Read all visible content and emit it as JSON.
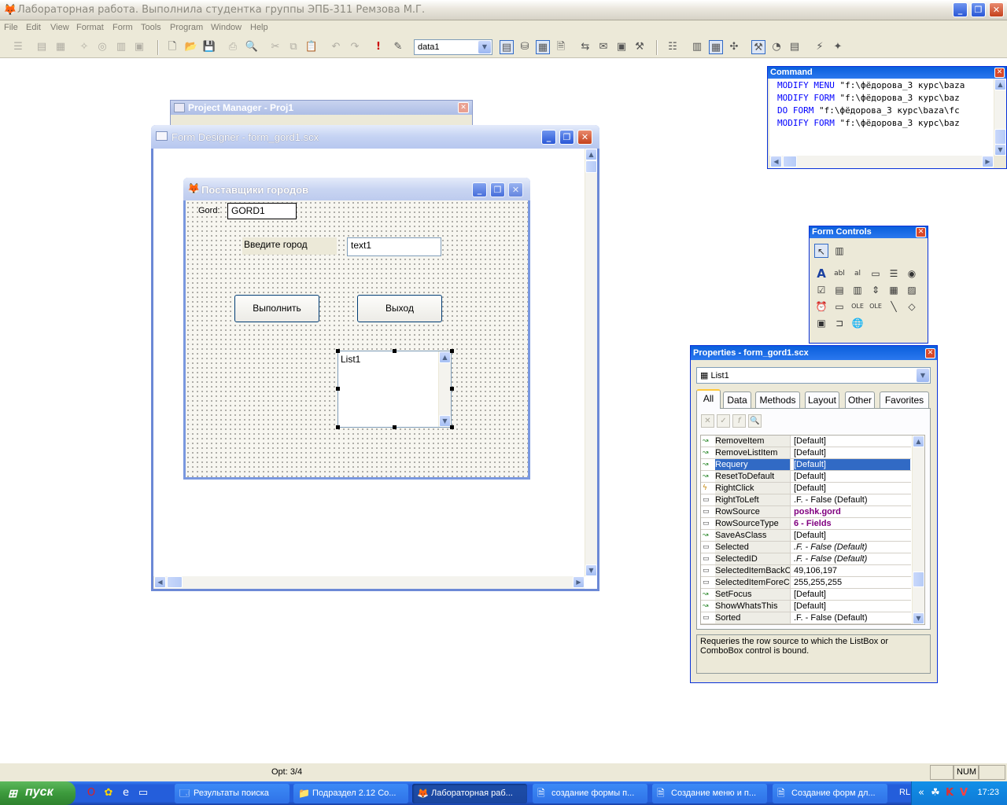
{
  "app": {
    "title": "Лабораторная работа. Выполнила студентка группы ЭПБ-311 Ремзова М.Г.",
    "controls": {
      "minimize": "_",
      "maximize": "❐",
      "close": "✕"
    }
  },
  "menu": [
    "File",
    "Edit",
    "View",
    "Format",
    "Form",
    "Tools",
    "Program",
    "Window",
    "Help"
  ],
  "toolbar": {
    "datasession_combo": "data1"
  },
  "command_window": {
    "title": "Command",
    "lines": [
      {
        "kw": "MODIFY MENU",
        "arg": "\"f:\\фёдорова_3 курс\\baza"
      },
      {
        "kw": "MODIFY FORM",
        "arg": "\"f:\\фёдорова_3 курс\\baz"
      },
      {
        "kw": "DO FORM",
        "arg": "\"f:\\фёдорова_3 курс\\baza\\fc"
      },
      {
        "kw": "MODIFY FORM",
        "arg": "\"f:\\фёдорова_3 курс\\baz"
      }
    ]
  },
  "project_manager": {
    "title": "Project Manager - Proj1"
  },
  "form_designer": {
    "title": "Form Designer - form_gord1.scx",
    "form": {
      "caption": "Поставщики городов",
      "label_gord": "Gord:",
      "textbox_gord": "GORD1",
      "label_city": "Введите город",
      "textbox_text1": "text1",
      "btn_execute": "Выполнить",
      "btn_exit": "Выход",
      "list": "List1"
    }
  },
  "form_controls": {
    "title": "Form Controls"
  },
  "properties": {
    "title": "Properties - form_gord1.scx",
    "object": "List1",
    "tabs": [
      "All",
      "Data",
      "Methods",
      "Layout",
      "Other",
      "Favorites"
    ],
    "active_tab": "All",
    "rows": [
      {
        "name": "RemoveItem",
        "value": "[Default]",
        "icon": "method"
      },
      {
        "name": "RemoveListItem",
        "value": "[Default]",
        "icon": "method"
      },
      {
        "name": "Requery",
        "value": "[Default]",
        "icon": "method",
        "selected": true
      },
      {
        "name": "ResetToDefault",
        "value": "[Default]",
        "icon": "method"
      },
      {
        "name": "RightClick",
        "value": "[Default]",
        "icon": "event"
      },
      {
        "name": "RightToLeft",
        "value": ".F. - False (Default)",
        "icon": "prop"
      },
      {
        "name": "RowSource",
        "value": "poshk.gord",
        "icon": "prop",
        "style": "bold"
      },
      {
        "name": "RowSourceType",
        "value": "6 - Fields",
        "icon": "prop",
        "style": "bold"
      },
      {
        "name": "SaveAsClass",
        "value": "[Default]",
        "icon": "method"
      },
      {
        "name": "Selected",
        "value": ".F. - False (Default)",
        "icon": "prop",
        "style": "ital"
      },
      {
        "name": "SelectedID",
        "value": ".F. - False (Default)",
        "icon": "prop",
        "style": "ital"
      },
      {
        "name": "SelectedItemBackColor",
        "value": "49,106,197",
        "icon": "prop"
      },
      {
        "name": "SelectedItemForeColor",
        "value": "255,255,255",
        "icon": "prop"
      },
      {
        "name": "SetFocus",
        "value": "[Default]",
        "icon": "method"
      },
      {
        "name": "ShowWhatsThis",
        "value": "[Default]",
        "icon": "method"
      },
      {
        "name": "Sorted",
        "value": ".F. - False (Default)",
        "icon": "prop"
      }
    ],
    "description": "Requeries the row source to which the ListBox or ComboBox control is bound."
  },
  "statusbar": {
    "record": "Opt: 3/4",
    "num": "NUM"
  },
  "taskbar": {
    "start": "пуск",
    "tasks": [
      {
        "label": "Результаты поиска",
        "active": false
      },
      {
        "label": "Подраздел 2.12 Со...",
        "active": false
      },
      {
        "label": "Лабораторная раб...",
        "active": true
      },
      {
        "label": "создание формы п...",
        "active": false
      },
      {
        "label": "Создание меню и п...",
        "active": false
      },
      {
        "label": "Создание форм дл...",
        "active": false
      }
    ],
    "lang": "RL",
    "clock": "17:23"
  },
  "colors": {
    "selection": "#316ac5",
    "accent_title": "#0a5fdc",
    "keyword": "#0000ff"
  }
}
